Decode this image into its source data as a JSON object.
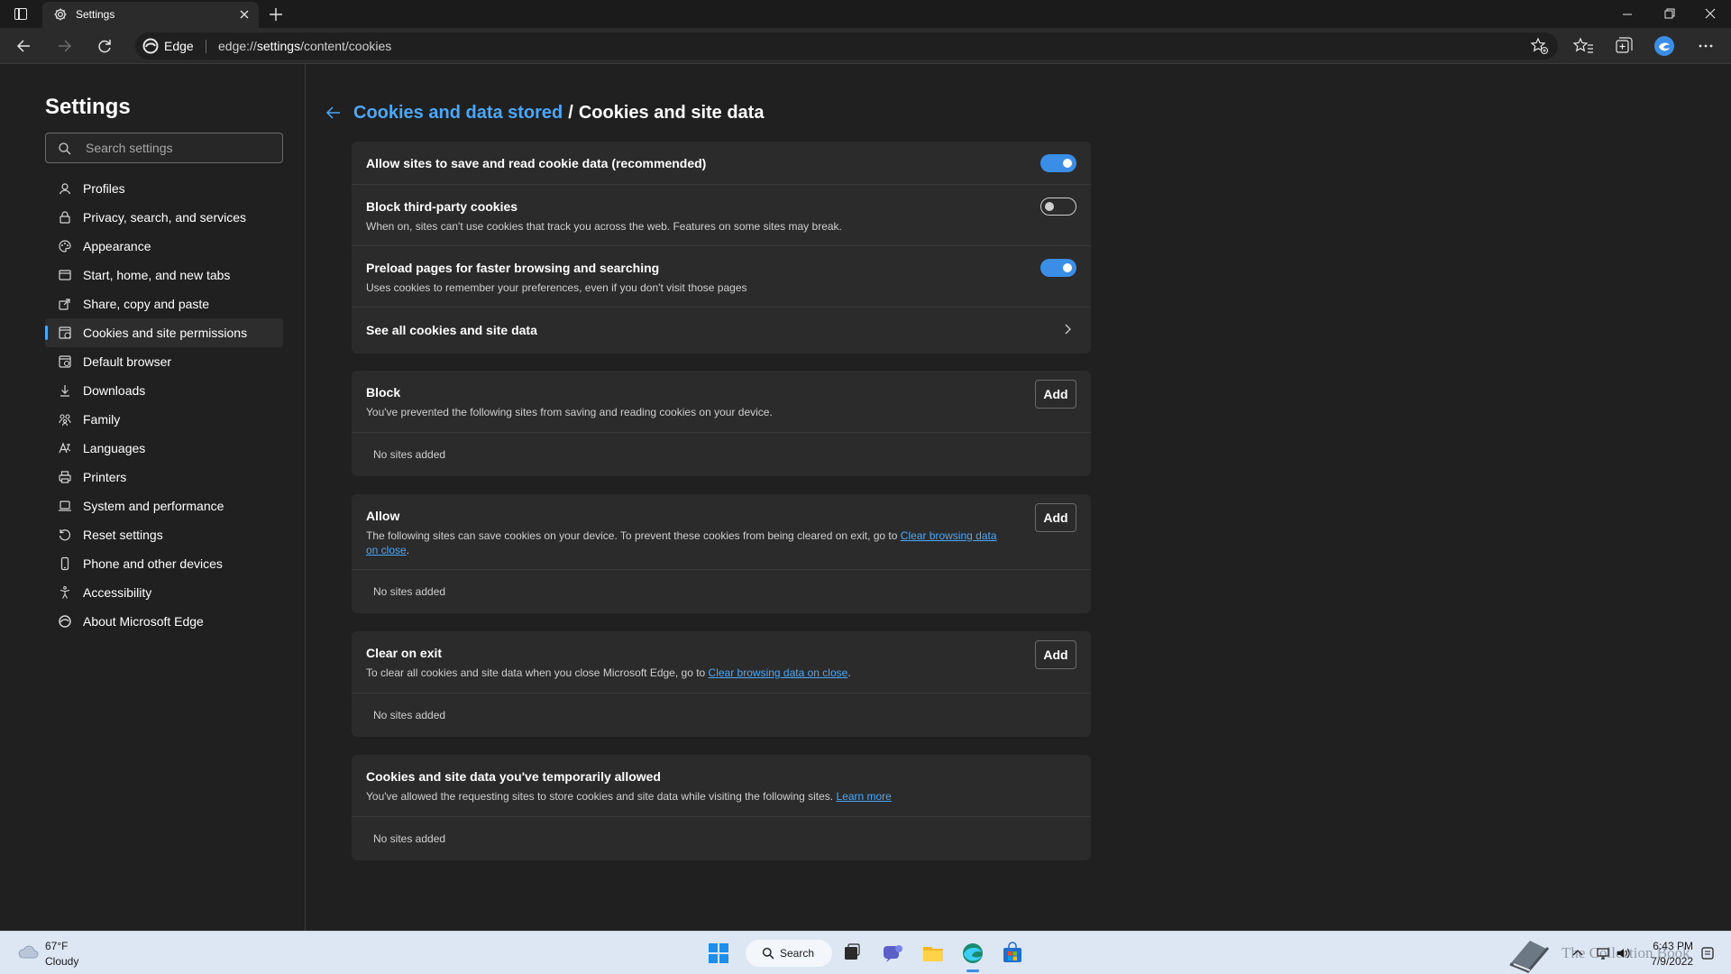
{
  "browser": {
    "tab_title": "Settings",
    "site_label": "Edge",
    "url_prefix": "edge://",
    "url_host": "settings",
    "url_path": "/content/cookies"
  },
  "sidebar": {
    "title": "Settings",
    "search_placeholder": "Search settings",
    "items": [
      {
        "label": "Profiles",
        "icon": "profile-icon"
      },
      {
        "label": "Privacy, search, and services",
        "icon": "lock-icon"
      },
      {
        "label": "Appearance",
        "icon": "palette-icon"
      },
      {
        "label": "Start, home, and new tabs",
        "icon": "window-icon"
      },
      {
        "label": "Share, copy and paste",
        "icon": "share-icon"
      },
      {
        "label": "Cookies and site permissions",
        "icon": "cookie-icon",
        "active": true
      },
      {
        "label": "Default browser",
        "icon": "browser-icon"
      },
      {
        "label": "Downloads",
        "icon": "download-icon"
      },
      {
        "label": "Family",
        "icon": "family-icon"
      },
      {
        "label": "Languages",
        "icon": "language-icon"
      },
      {
        "label": "Printers",
        "icon": "printer-icon"
      },
      {
        "label": "System and performance",
        "icon": "laptop-icon"
      },
      {
        "label": "Reset settings",
        "icon": "reset-icon"
      },
      {
        "label": "Phone and other devices",
        "icon": "phone-icon"
      },
      {
        "label": "Accessibility",
        "icon": "accessibility-icon"
      },
      {
        "label": "About Microsoft Edge",
        "icon": "edge-icon"
      }
    ]
  },
  "breadcrumb": {
    "parent": "Cookies and data stored",
    "separator": "/",
    "current": "Cookies and site data"
  },
  "settings": {
    "allow_save": {
      "title": "Allow sites to save and read cookie data (recommended)",
      "enabled": true
    },
    "block_third_party": {
      "title": "Block third-party cookies",
      "desc": "When on, sites can't use cookies that track you across the web. Features on some sites may break.",
      "enabled": false
    },
    "preload": {
      "title": "Preload pages for faster browsing and searching",
      "desc": "Uses cookies to remember your preferences, even if you don't visit those pages",
      "enabled": true
    },
    "see_all": {
      "title": "See all cookies and site data"
    }
  },
  "lists": {
    "add_label": "Add",
    "empty_label": "No sites added",
    "block": {
      "title": "Block",
      "desc": "You've prevented the following sites from saving and reading cookies on your device."
    },
    "allow": {
      "title": "Allow",
      "desc": "The following sites can save cookies on your device. To prevent these cookies from being cleared on exit, go to ",
      "link": "Clear browsing data on close",
      "desc_end": "."
    },
    "clear_on_exit": {
      "title": "Clear on exit",
      "desc": "To clear all cookies and site data when you close Microsoft Edge, go to ",
      "link": "Clear browsing data on close",
      "desc_end": "."
    },
    "temporary": {
      "title": "Cookies and site data you've temporarily allowed",
      "desc": "You've allowed the requesting sites to store cookies and site data while visiting the following sites. ",
      "link": "Learn more"
    }
  },
  "taskbar": {
    "temperature": "67°F",
    "condition": "Cloudy",
    "search_label": "Search",
    "time": "6:43 PM",
    "date": "7/9/2022",
    "watermark": "The Collection Book"
  },
  "colors": {
    "accent": "#4ca7f7",
    "toggle_on": "#3a8ee6",
    "page_bg": "#202020",
    "card_bg": "#2b2b2b"
  }
}
